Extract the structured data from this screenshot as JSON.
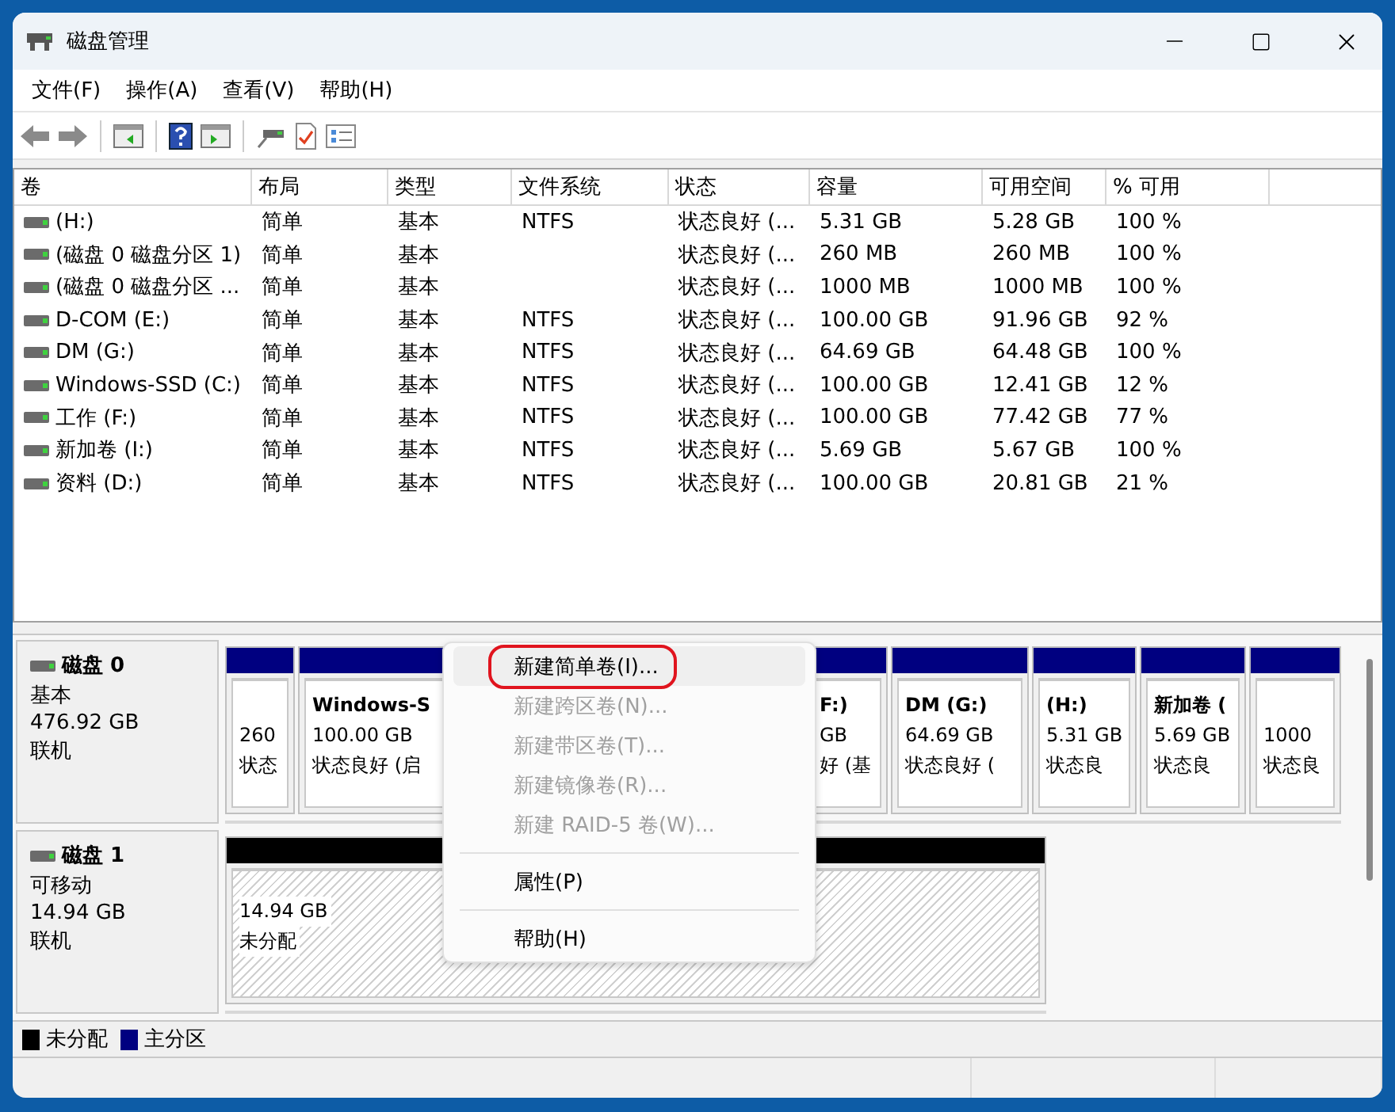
{
  "window": {
    "title": "磁盘管理"
  },
  "menu": [
    "文件(F)",
    "操作(A)",
    "查看(V)",
    "帮助(H)"
  ],
  "volumes": {
    "columns": [
      "卷",
      "布局",
      "类型",
      "文件系统",
      "状态",
      "容量",
      "可用空间",
      "% 可用"
    ],
    "rows": [
      [
        "(H:)",
        "简单",
        "基本",
        "NTFS",
        "状态良好 (...",
        "5.31 GB",
        "5.28 GB",
        "100 %"
      ],
      [
        "(磁盘 0 磁盘分区 1)",
        "简单",
        "基本",
        "",
        "状态良好 (...",
        "260 MB",
        "260 MB",
        "100 %"
      ],
      [
        "(磁盘 0 磁盘分区 ...",
        "简单",
        "基本",
        "",
        "状态良好 (...",
        "1000 MB",
        "1000 MB",
        "100 %"
      ],
      [
        "D-COM (E:)",
        "简单",
        "基本",
        "NTFS",
        "状态良好 (...",
        "100.00 GB",
        "91.96 GB",
        "92 %"
      ],
      [
        "DM (G:)",
        "简单",
        "基本",
        "NTFS",
        "状态良好 (...",
        "64.69 GB",
        "64.48 GB",
        "100 %"
      ],
      [
        "Windows-SSD (C:)",
        "简单",
        "基本",
        "NTFS",
        "状态良好 (...",
        "100.00 GB",
        "12.41 GB",
        "12 %"
      ],
      [
        "工作 (F:)",
        "简单",
        "基本",
        "NTFS",
        "状态良好 (...",
        "100.00 GB",
        "77.42 GB",
        "77 %"
      ],
      [
        "新加卷 (I:)",
        "简单",
        "基本",
        "NTFS",
        "状态良好 (...",
        "5.69 GB",
        "5.67 GB",
        "100 %"
      ],
      [
        "资料 (D:)",
        "简单",
        "基本",
        "NTFS",
        "状态良好 (...",
        "100.00 GB",
        "20.81 GB",
        "21 %"
      ]
    ]
  },
  "disks": [
    {
      "name": "磁盘 0",
      "type": "基本",
      "size": "476.92 GB",
      "status": "联机",
      "partitions": [
        {
          "kind": "primary",
          "lines": [
            "260",
            "状态"
          ]
        },
        {
          "kind": "primary",
          "title": "Windows-S",
          "lines": [
            "100.00 GB",
            "状态良好 (启"
          ]
        },
        {
          "kind": "primary_tail",
          "title": "F:)",
          "lines": [
            "GB",
            "好 (基"
          ]
        },
        {
          "kind": "primary",
          "title": "DM  (G:)",
          "lines": [
            "64.69 GB",
            "状态良好 ("
          ]
        },
        {
          "kind": "primary",
          "title": "(H:)",
          "lines": [
            "5.31 GB",
            "状态良"
          ]
        },
        {
          "kind": "primary",
          "title": "新加卷 (",
          "lines": [
            "5.69 GB",
            "状态良"
          ]
        },
        {
          "kind": "primary",
          "lines": [
            "1000",
            "状态良"
          ]
        }
      ]
    },
    {
      "name": "磁盘 1",
      "type": "可移动",
      "size": "14.94 GB",
      "status": "联机",
      "partitions": [
        {
          "kind": "unallocated",
          "lines": [
            "14.94 GB",
            "未分配"
          ]
        }
      ]
    }
  ],
  "context_menu": [
    {
      "kind": "item",
      "label": "新建简单卷(I)...",
      "disabled": false,
      "selected": true,
      "circled": true
    },
    {
      "kind": "item",
      "label": "新建跨区卷(N)...",
      "disabled": true,
      "selected": false,
      "circled": false
    },
    {
      "kind": "item",
      "label": "新建带区卷(T)...",
      "disabled": true,
      "selected": false,
      "circled": false
    },
    {
      "kind": "item",
      "label": "新建镜像卷(R)...",
      "disabled": true,
      "selected": false,
      "circled": false
    },
    {
      "kind": "item",
      "label": "新建 RAID-5 卷(W)...",
      "disabled": true,
      "selected": false,
      "circled": false
    },
    {
      "kind": "separator"
    },
    {
      "kind": "item",
      "label": "属性(P)",
      "disabled": false,
      "selected": false,
      "circled": false
    },
    {
      "kind": "separator"
    },
    {
      "kind": "item",
      "label": "帮助(H)",
      "disabled": false,
      "selected": false,
      "circled": false
    }
  ],
  "legend": [
    {
      "label": "未分配",
      "color": "#000000"
    },
    {
      "label": "主分区",
      "color": "#000080"
    }
  ]
}
